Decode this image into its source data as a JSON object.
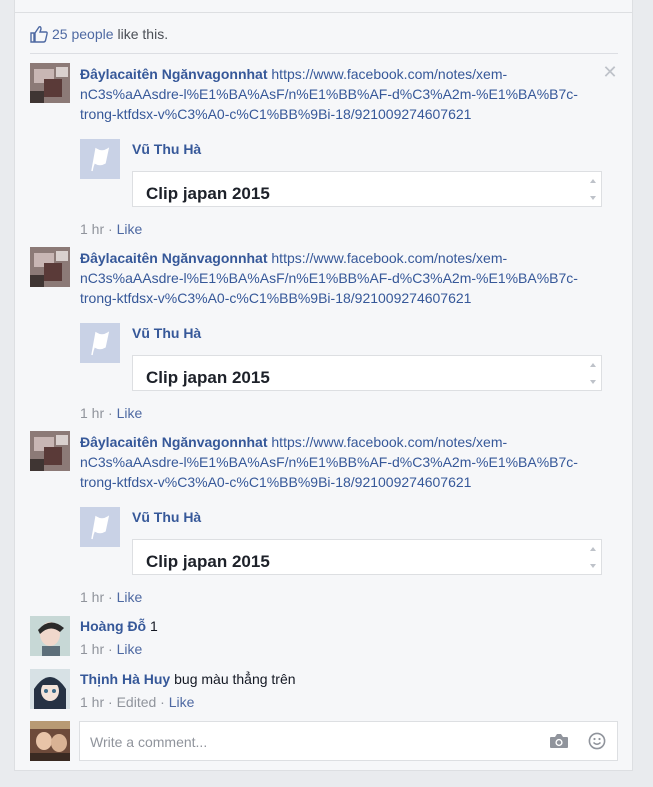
{
  "likes": {
    "count": "25 people",
    "suffix": "like this."
  },
  "comments": [
    {
      "author": "Đâylacaitên Ngănvagonnhat",
      "link": "https://www.facebook.com/notes/xem-nC3s%aAAsdre-l%E1%BA%AsF/n%E1%BB%AF-d%C3%A2m-%E1%BA%B7c-trong-ktfdsx-v%C3%A0-c%C1%BB%9Bi-18/921009274607621",
      "share_name": "Vũ Thu Hà",
      "note_title": "Clip japan 2015",
      "time": "1 hr",
      "like": "Like"
    },
    {
      "author": "Đâylacaitên Ngănvagonnhat",
      "link": "https://www.facebook.com/notes/xem-nC3s%aAAsdre-l%E1%BA%AsF/n%E1%BB%AF-d%C3%A2m-%E1%BA%B7c-trong-ktfdsx-v%C3%A0-c%C1%BB%9Bi-18/921009274607621",
      "share_name": "Vũ Thu Hà",
      "note_title": "Clip japan 2015",
      "time": "1 hr",
      "like": "Like"
    },
    {
      "author": "Đâylacaitên Ngănvagonnhat",
      "link": "https://www.facebook.com/notes/xem-nC3s%aAAsdre-l%E1%BA%AsF/n%E1%BB%AF-d%C3%A2m-%E1%BA%B7c-trong-ktfdsx-v%C3%A0-c%C1%BB%9Bi-18/921009274607621",
      "share_name": "Vũ Thu Hà",
      "note_title": "Clip japan 2015",
      "time": "1 hr",
      "like": "Like"
    },
    {
      "author": "Hoàng Đỗ",
      "text": "1",
      "time": "1 hr",
      "like": "Like"
    },
    {
      "author": "Thịnh Hà Huy",
      "text": "bug màu thẳng trên",
      "time": "1 hr",
      "edited": "Edited",
      "like": "Like"
    }
  ],
  "composer": {
    "placeholder": "Write a comment..."
  },
  "icons": {
    "like": "thumbs-up-icon",
    "close": "close-icon",
    "camera": "camera-icon",
    "emoji": "smiley-icon",
    "flag": "flag-icon"
  },
  "colors": {
    "link": "#365899",
    "meta": "#90949c",
    "background": "#f6f7f9"
  }
}
